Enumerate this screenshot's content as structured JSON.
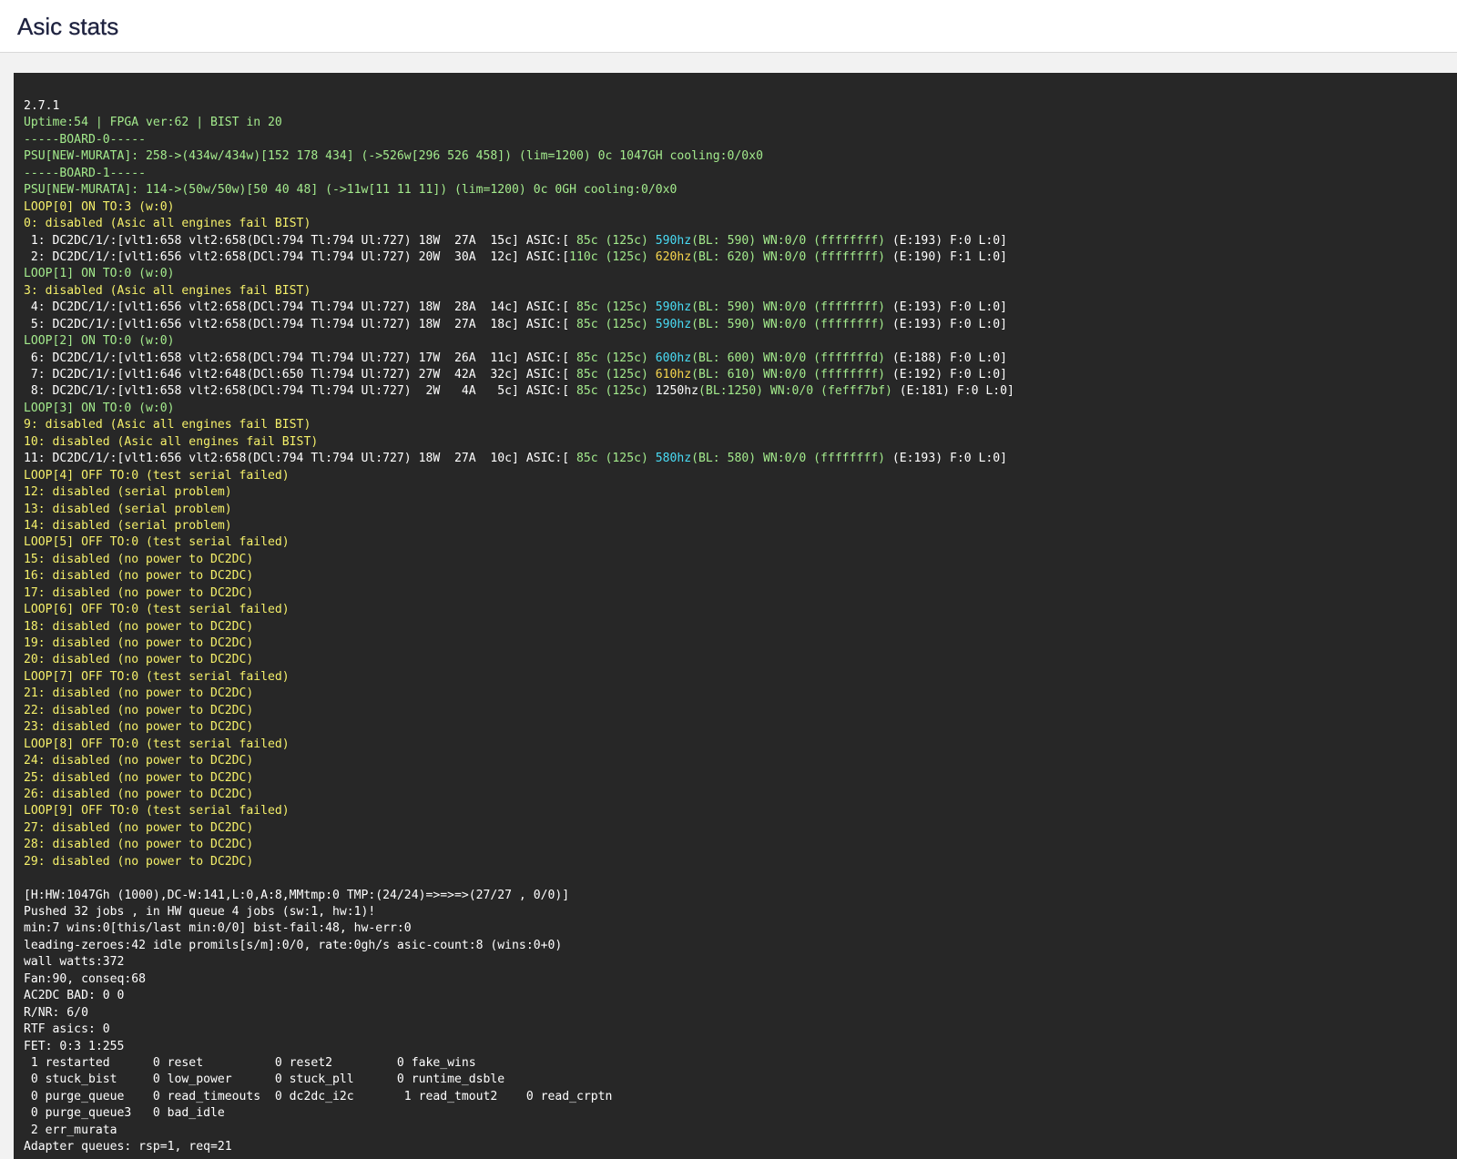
{
  "header": {
    "title": "Asic stats"
  },
  "colors": {
    "white": "#ffffff",
    "green": "#a3ea8c",
    "yellow": "#f5f06a",
    "cyan": "#49dcf5",
    "orange": "#f8d64e",
    "console_bg": "#272727"
  },
  "console": {
    "lines": [
      [
        [
          "white",
          "2.7.1"
        ]
      ],
      [
        [
          "green",
          "Uptime:54 | FPGA ver:62 | BIST in 20"
        ]
      ],
      [
        [
          "green",
          "-----BOARD-0-----"
        ]
      ],
      [
        [
          "green",
          "PSU[NEW-MURATA]: 258->(434w/434w)[152 178 434] (->526w[296 526 458]) (lim=1200) 0c 1047GH cooling:0/0x0"
        ]
      ],
      [
        [
          "green",
          "-----BOARD-1-----"
        ]
      ],
      [
        [
          "green",
          "PSU[NEW-MURATA]: 114->(50w/50w)[50 40 48] (->11w[11 11 11]) (lim=1200) 0c 0GH cooling:0/0x0"
        ]
      ],
      [
        [
          "yellow",
          "LOOP[0] ON TO:3 (w:0)"
        ]
      ],
      [
        [
          "yellow",
          "0: disabled (Asic all engines fail BIST)"
        ]
      ],
      [
        [
          "white",
          " 1: DC2DC/1/:[vlt1:658 vlt2:658(DCl:794 Tl:794 Ul:727) 18W  27A  15c] ASIC:["
        ],
        [
          "green",
          " 85c (125c) "
        ],
        [
          "cyan",
          "590hz"
        ],
        [
          "green",
          "(BL: 590) WN:0/0 (ffffffff)"
        ],
        [
          "white",
          " (E:193) F:0 L:0]"
        ]
      ],
      [
        [
          "white",
          " 2: DC2DC/1/:[vlt1:656 vlt2:658(DCl:794 Tl:794 Ul:727) 20W  30A  12c] ASIC:["
        ],
        [
          "green",
          "110c (125c) "
        ],
        [
          "orange",
          "620hz"
        ],
        [
          "green",
          "(BL: 620) WN:0/0 (ffffffff)"
        ],
        [
          "white",
          " (E:190) F:1 L:0]"
        ]
      ],
      [
        [
          "green",
          "LOOP[1] ON TO:0 (w:0)"
        ]
      ],
      [
        [
          "yellow",
          "3: disabled (Asic all engines fail BIST)"
        ]
      ],
      [
        [
          "white",
          " 4: DC2DC/1/:[vlt1:656 vlt2:658(DCl:794 Tl:794 Ul:727) 18W  28A  14c] ASIC:["
        ],
        [
          "green",
          " 85c (125c) "
        ],
        [
          "cyan",
          "590hz"
        ],
        [
          "green",
          "(BL: 590) WN:0/0 (ffffffff)"
        ],
        [
          "white",
          " (E:193) F:0 L:0]"
        ]
      ],
      [
        [
          "white",
          " 5: DC2DC/1/:[vlt1:656 vlt2:658(DCl:794 Tl:794 Ul:727) 18W  27A  18c] ASIC:["
        ],
        [
          "green",
          " 85c (125c) "
        ],
        [
          "cyan",
          "590hz"
        ],
        [
          "green",
          "(BL: 590) WN:0/0 (ffffffff)"
        ],
        [
          "white",
          " (E:193) F:0 L:0]"
        ]
      ],
      [
        [
          "green",
          "LOOP[2] ON TO:0 (w:0)"
        ]
      ],
      [
        [
          "white",
          " 6: DC2DC/1/:[vlt1:658 vlt2:658(DCl:794 Tl:794 Ul:727) 17W  26A  11c] ASIC:["
        ],
        [
          "green",
          " 85c (125c) "
        ],
        [
          "cyan",
          "600hz"
        ],
        [
          "green",
          "(BL: 600) WN:0/0 (fffffffd)"
        ],
        [
          "white",
          " (E:188) F:0 L:0]"
        ]
      ],
      [
        [
          "white",
          " 7: DC2DC/1/:[vlt1:646 vlt2:648(DCl:650 Tl:794 Ul:727) 27W  42A  32c] ASIC:["
        ],
        [
          "green",
          " 85c (125c) "
        ],
        [
          "orange",
          "610hz"
        ],
        [
          "green",
          "(BL: 610) WN:0/0 (ffffffff)"
        ],
        [
          "white",
          " (E:192) F:0 L:0]"
        ]
      ],
      [
        [
          "white",
          " 8: DC2DC/1/:[vlt1:658 vlt2:658(DCl:794 Tl:794 Ul:727)  2W   4A   5c] ASIC:["
        ],
        [
          "green",
          " 85c (125c) "
        ],
        [
          "white",
          "1250hz"
        ],
        [
          "green",
          "(BL:1250) WN:0/0 (fefff7bf)"
        ],
        [
          "white",
          " (E:181) F:0 L:0]"
        ]
      ],
      [
        [
          "green",
          "LOOP[3] ON TO:0 (w:0)"
        ]
      ],
      [
        [
          "yellow",
          "9: disabled (Asic all engines fail BIST)"
        ]
      ],
      [
        [
          "yellow",
          "10: disabled (Asic all engines fail BIST)"
        ]
      ],
      [
        [
          "white",
          "11: DC2DC/1/:[vlt1:656 vlt2:658(DCl:794 Tl:794 Ul:727) 18W  27A  10c] ASIC:["
        ],
        [
          "green",
          " 85c (125c) "
        ],
        [
          "cyan",
          "580hz"
        ],
        [
          "green",
          "(BL: 580) WN:0/0 (ffffffff)"
        ],
        [
          "white",
          " (E:193) F:0 L:0]"
        ]
      ],
      [
        [
          "yellow",
          "LOOP[4] OFF TO:0 (test serial failed)"
        ]
      ],
      [
        [
          "yellow",
          "12: disabled (serial problem)"
        ]
      ],
      [
        [
          "yellow",
          "13: disabled (serial problem)"
        ]
      ],
      [
        [
          "yellow",
          "14: disabled (serial problem)"
        ]
      ],
      [
        [
          "yellow",
          "LOOP[5] OFF TO:0 (test serial failed)"
        ]
      ],
      [
        [
          "yellow",
          "15: disabled (no power to DC2DC)"
        ]
      ],
      [
        [
          "yellow",
          "16: disabled (no power to DC2DC)"
        ]
      ],
      [
        [
          "yellow",
          "17: disabled (no power to DC2DC)"
        ]
      ],
      [
        [
          "yellow",
          "LOOP[6] OFF TO:0 (test serial failed)"
        ]
      ],
      [
        [
          "yellow",
          "18: disabled (no power to DC2DC)"
        ]
      ],
      [
        [
          "yellow",
          "19: disabled (no power to DC2DC)"
        ]
      ],
      [
        [
          "yellow",
          "20: disabled (no power to DC2DC)"
        ]
      ],
      [
        [
          "yellow",
          "LOOP[7] OFF TO:0 (test serial failed)"
        ]
      ],
      [
        [
          "yellow",
          "21: disabled (no power to DC2DC)"
        ]
      ],
      [
        [
          "yellow",
          "22: disabled (no power to DC2DC)"
        ]
      ],
      [
        [
          "yellow",
          "23: disabled (no power to DC2DC)"
        ]
      ],
      [
        [
          "yellow",
          "LOOP[8] OFF TO:0 (test serial failed)"
        ]
      ],
      [
        [
          "yellow",
          "24: disabled (no power to DC2DC)"
        ]
      ],
      [
        [
          "yellow",
          "25: disabled (no power to DC2DC)"
        ]
      ],
      [
        [
          "yellow",
          "26: disabled (no power to DC2DC)"
        ]
      ],
      [
        [
          "yellow",
          "LOOP[9] OFF TO:0 (test serial failed)"
        ]
      ],
      [
        [
          "yellow",
          "27: disabled (no power to DC2DC)"
        ]
      ],
      [
        [
          "yellow",
          "28: disabled (no power to DC2DC)"
        ]
      ],
      [
        [
          "yellow",
          "29: disabled (no power to DC2DC)"
        ]
      ],
      [],
      [
        [
          "white",
          "[H:HW:1047Gh (1000),DC-W:141,L:0,A:8,MMtmp:0 TMP:(24/24)=>=>=>(27/27 , 0/0)]"
        ]
      ],
      [
        [
          "white",
          "Pushed 32 jobs , in HW queue 4 jobs (sw:1, hw:1)!"
        ]
      ],
      [
        [
          "white",
          "min:7 wins:0[this/last min:0/0] bist-fail:48, hw-err:0"
        ]
      ],
      [
        [
          "white",
          "leading-zeroes:42 idle promils[s/m]:0/0, rate:0gh/s asic-count:8 (wins:0+0)"
        ]
      ],
      [
        [
          "white",
          "wall watts:372"
        ]
      ],
      [
        [
          "white",
          "Fan:90, conseq:68"
        ]
      ],
      [
        [
          "white",
          "AC2DC BAD: 0 0"
        ]
      ],
      [
        [
          "white",
          "R/NR: 6/0"
        ]
      ],
      [
        [
          "white",
          "RTF asics: 0"
        ]
      ],
      [
        [
          "white",
          "FET: 0:3 1:255"
        ]
      ],
      [
        [
          "white",
          " 1 restarted      0 reset          0 reset2         0 fake_wins"
        ]
      ],
      [
        [
          "white",
          " 0 stuck_bist     0 low_power      0 stuck_pll      0 runtime_dsble"
        ]
      ],
      [
        [
          "white",
          " 0 purge_queue    0 read_timeouts  0 dc2dc_i2c       1 read_tmout2    0 read_crptn"
        ]
      ],
      [
        [
          "white",
          " 0 purge_queue3   0 bad_idle"
        ]
      ],
      [
        [
          "white",
          " 2 err_murata"
        ]
      ],
      [
        [
          "white",
          "Adapter queues: rsp=1, req=21"
        ]
      ]
    ]
  }
}
